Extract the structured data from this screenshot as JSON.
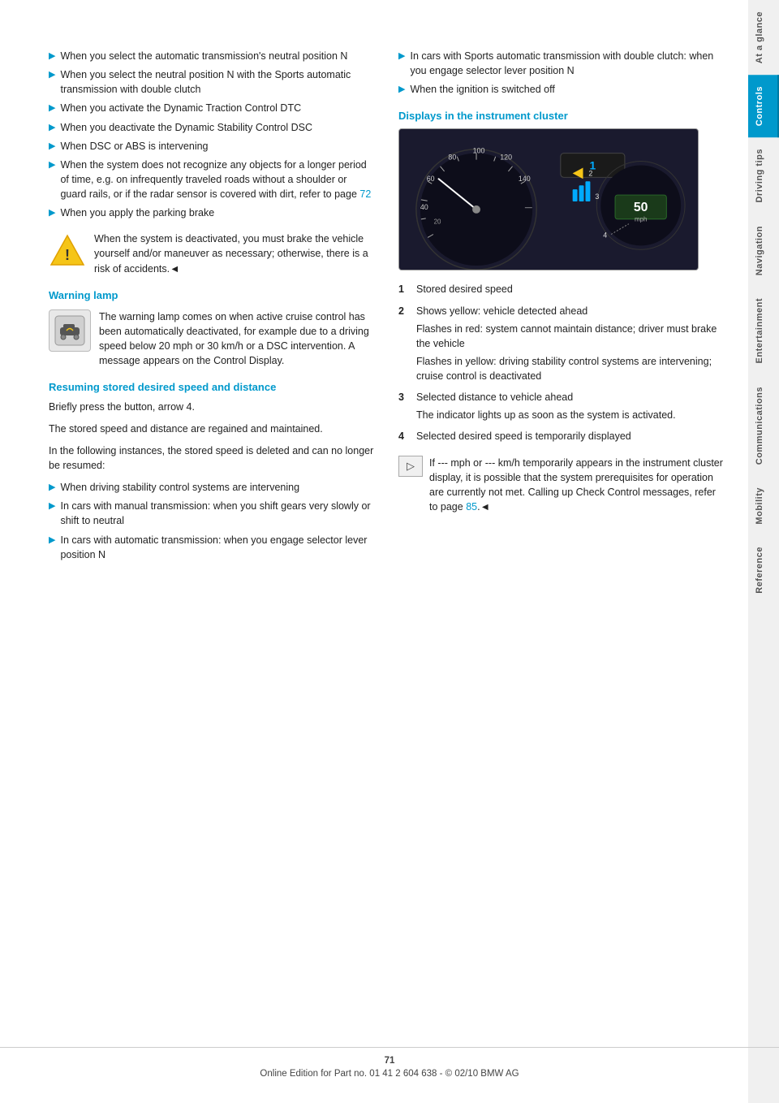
{
  "page": {
    "number": "71",
    "footer_text": "Online Edition for Part no. 01 41 2 604 638 - © 02/10 BMW AG"
  },
  "sidebar": {
    "tabs": [
      {
        "label": "At a glance",
        "active": false
      },
      {
        "label": "Controls",
        "active": true
      },
      {
        "label": "Driving tips",
        "active": false
      },
      {
        "label": "Navigation",
        "active": false
      },
      {
        "label": "Entertainment",
        "active": false
      },
      {
        "label": "Communications",
        "active": false
      },
      {
        "label": "Mobility",
        "active": false
      },
      {
        "label": "Reference",
        "active": false
      }
    ]
  },
  "left_column": {
    "bullet_items": [
      "When you select the automatic transmission's neutral position N",
      "When you select the neutral position N with the Sports automatic transmission with double clutch",
      "When you activate the Dynamic Traction Control DTC",
      "When you deactivate the Dynamic Stability Control DSC",
      "When DSC or ABS is intervening",
      "When the system does not recognize any objects for a longer period of time, e.g. on infrequently traveled roads without a shoulder or guard rails, or if the radar sensor is covered with dirt, refer to page 72",
      "When you apply the parking brake"
    ],
    "warning_text": "When the system is deactivated, you must brake the vehicle yourself and/or maneuver as necessary; otherwise, there is a risk of accidents.◄",
    "warning_lamp_section": {
      "heading": "Warning lamp",
      "text": "The warning lamp comes on when active cruise control has been automatically deactivated, for example due to a driving speed below 20 mph or 30 km/h or a DSC intervention. A message appears on the Control Display."
    },
    "resuming_section": {
      "heading": "Resuming stored desired speed and distance",
      "para1": "Briefly press the button, arrow 4.",
      "para2": "The stored speed and distance are regained and maintained.",
      "para3": "In the following instances, the stored speed is deleted and can no longer be resumed:",
      "sub_bullets": [
        "When driving stability control systems are intervening",
        "In cars with manual transmission: when you shift gears very slowly or shift to neutral",
        "In cars with automatic transmission: when you engage selector lever position N"
      ]
    }
  },
  "right_column": {
    "right_bullets": [
      "In cars with Sports automatic transmission with double clutch: when you engage selector lever position N",
      "When the ignition is switched off"
    ],
    "display_section": {
      "heading": "Displays in the instrument cluster",
      "numbered_items": [
        {
          "num": "1",
          "text": "Stored desired speed"
        },
        {
          "num": "2",
          "text": "Shows yellow: vehicle detected ahead",
          "sub1": "Flashes in red: system cannot maintain distance; driver must brake the vehicle",
          "sub2": "Flashes in yellow: driving stability control systems are intervening; cruise control is deactivated"
        },
        {
          "num": "3",
          "text": "Selected distance to vehicle ahead",
          "sub1": "The indicator lights up as soon as the system is activated."
        },
        {
          "num": "4",
          "text": "Selected desired speed is temporarily displayed"
        }
      ]
    },
    "note_text": "If --- mph or --- km/h temporarily appears in the instrument cluster display, it is possible that the system prerequisites for operation are currently not met. Calling up Check Control messages, refer to page 85.◄",
    "page_ref": "85"
  }
}
